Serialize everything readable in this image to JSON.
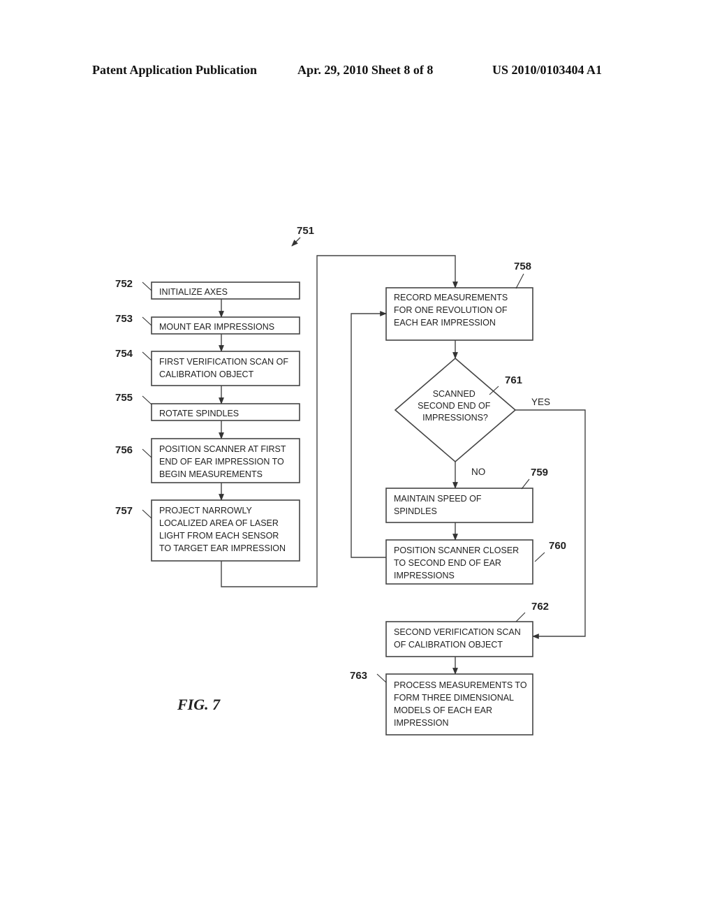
{
  "header": {
    "publication": "Patent Application Publication",
    "date_sheet": "Apr. 29, 2010  Sheet 8 of 8",
    "pub_number": "US 2010/0103404 A1"
  },
  "figure": {
    "label": "FIG. 7",
    "ref": "751"
  },
  "steps": {
    "s752": {
      "ref": "752",
      "lines": [
        "INITIALIZE AXES"
      ]
    },
    "s753": {
      "ref": "753",
      "lines": [
        "MOUNT EAR IMPRESSIONS"
      ]
    },
    "s754": {
      "ref": "754",
      "lines": [
        "FIRST VERIFICATION SCAN OF",
        "CALIBRATION OBJECT"
      ]
    },
    "s755": {
      "ref": "755",
      "lines": [
        "ROTATE SPINDLES"
      ]
    },
    "s756": {
      "ref": "756",
      "lines": [
        "POSITION SCANNER AT FIRST",
        "END OF EAR IMPRESSION TO",
        "BEGIN MEASUREMENTS"
      ]
    },
    "s757": {
      "ref": "757",
      "lines": [
        "PROJECT NARROWLY",
        "LOCALIZED AREA OF LASER",
        "LIGHT FROM EACH SENSOR",
        "TO TARGET EAR IMPRESSION"
      ]
    },
    "s758": {
      "ref": "758",
      "lines": [
        "RECORD MEASUREMENTS",
        "FOR ONE REVOLUTION OF",
        "EACH EAR IMPRESSION"
      ]
    },
    "s761": {
      "ref": "761",
      "lines": [
        "SCANNED",
        "SECOND END OF",
        "IMPRESSIONS?"
      ]
    },
    "s759": {
      "ref": "759",
      "lines": [
        "MAINTAIN SPEED OF",
        "SPINDLES"
      ]
    },
    "s760": {
      "ref": "760",
      "lines": [
        "POSITION SCANNER CLOSER",
        "TO SECOND END OF EAR",
        "IMPRESSIONS"
      ]
    },
    "s762": {
      "ref": "762",
      "lines": [
        "SECOND VERIFICATION SCAN",
        "OF CALIBRATION OBJECT"
      ]
    },
    "s763": {
      "ref": "763",
      "lines": [
        "PROCESS MEASUREMENTS TO",
        "FORM THREE DIMENSIONAL",
        "MODELS OF EACH EAR",
        "IMPRESSION"
      ]
    }
  },
  "branches": {
    "yes": "YES",
    "no": "NO"
  }
}
